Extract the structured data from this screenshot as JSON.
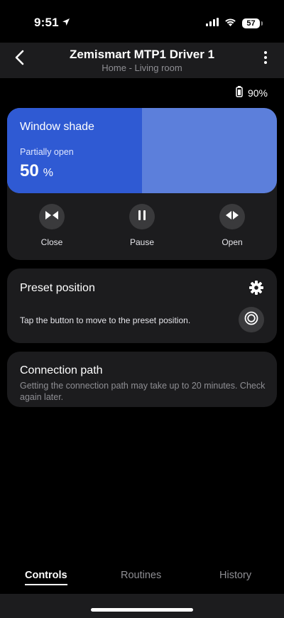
{
  "status_bar": {
    "time": "9:51",
    "battery_level": "57"
  },
  "header": {
    "title": "Zemismart MTP1 Driver 1",
    "subtitle": "Home - Living room"
  },
  "device_battery": {
    "level": "90%"
  },
  "shade": {
    "title": "Window shade",
    "status": "Partially open",
    "percent": "50",
    "unit": "%",
    "open_fraction": 0.5,
    "fill_color": "#2f5ad3",
    "track_color": "#5c7fdb"
  },
  "controls": [
    {
      "label": "Close",
      "icon": "close-shade-icon"
    },
    {
      "label": "Pause",
      "icon": "pause-icon"
    },
    {
      "label": "Open",
      "icon": "open-shade-icon"
    }
  ],
  "preset": {
    "title": "Preset position",
    "description": "Tap the button to move to the preset position.",
    "settings_icon": "gear-icon",
    "action_icon": "target-icon"
  },
  "connection": {
    "title": "Connection path",
    "description": "Getting the connection path may take up to 20 minutes. Check again later."
  },
  "tabs": [
    {
      "label": "Controls",
      "active": true
    },
    {
      "label": "Routines",
      "active": false
    },
    {
      "label": "History",
      "active": false
    }
  ]
}
